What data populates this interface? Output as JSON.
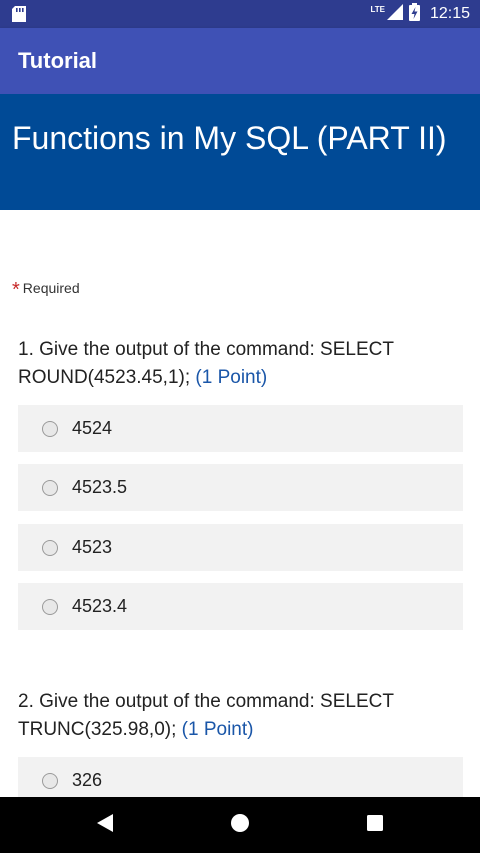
{
  "status_bar": {
    "network": "LTE",
    "time": "12:15"
  },
  "app_bar": {
    "title": "Tutorial"
  },
  "form": {
    "title": "Functions in My SQL (PART II)",
    "required_marker": "*",
    "required_label": "Required"
  },
  "questions": [
    {
      "text": "1. Give the output of the command: SELECT ROUND(4523.45,1);",
      "points": "(1 Point)",
      "options": [
        "4524",
        "4523.5",
        "4523",
        "4523.4"
      ]
    },
    {
      "text": "2. Give the output of the command: SELECT TRUNC(325.98,0);",
      "points": "(1 Point)",
      "options": [
        "326"
      ]
    }
  ],
  "nav_bar": {
    "icons": [
      "back-icon",
      "home-icon",
      "recents-icon"
    ]
  },
  "colors": {
    "status_bar": "#2e3c8f",
    "app_bar": "#3f51b5",
    "form_header": "#004a96",
    "points": "#1a56a8",
    "asterisk": "#c62828"
  }
}
